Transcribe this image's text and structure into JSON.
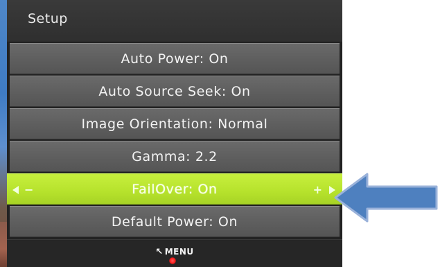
{
  "osd": {
    "title": "Setup",
    "items": [
      {
        "label": "Auto Power: On"
      },
      {
        "label": "Auto Source Seek: On"
      },
      {
        "label": "Image Orientation: Normal"
      },
      {
        "label": "Gamma: 2.2"
      },
      {
        "label": "FailOver: On",
        "selected": true
      },
      {
        "label": "Default Power: On"
      }
    ],
    "selected_controls": {
      "left_minus": "−",
      "right_plus": "+"
    },
    "footer": {
      "hint_icon": "back-arrow-icon",
      "hint_label": "MENU"
    }
  },
  "colors": {
    "panel_bg": "#222222",
    "item_bg": "#5e5e5e",
    "selected_bg": "#b6e22c",
    "arrow_fill": "#4e80bf",
    "arrow_stroke": "#9ab2da"
  }
}
